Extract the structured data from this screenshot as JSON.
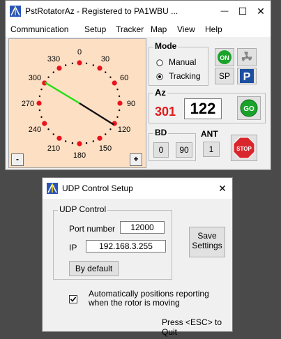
{
  "rotator": {
    "title": "PstRotatorAz - Registered to PA1WBU  ...",
    "caption": {
      "minimize": "—",
      "maximize": "☐",
      "close": "✕"
    },
    "menu": [
      "Communication",
      "Setup",
      "Tracker",
      "Map",
      "View",
      "Help"
    ],
    "dial": {
      "labels": [
        "0",
        "30",
        "60",
        "90",
        "120",
        "150",
        "180",
        "210",
        "240",
        "270",
        "300",
        "330"
      ],
      "green_bearing": 301,
      "black_bearing": 122,
      "minus": "-",
      "plus": "+"
    },
    "mode": {
      "title": "Mode",
      "manual": "Manual",
      "tracking": "Tracking",
      "selected": "tracking",
      "on_label": "ON",
      "sp_label": "SP",
      "p_label": "P"
    },
    "az": {
      "title": "Az",
      "target": "301",
      "current": "122",
      "go_label": "GO"
    },
    "bd": {
      "title": "BD",
      "btn0": "0",
      "btn90": "90"
    },
    "ant": {
      "title": "ANT",
      "btn1": "1"
    },
    "stop_label": "STOP"
  },
  "udp": {
    "title": "UDP Control Setup",
    "close": "✕",
    "group_title": "UDP Control",
    "port_label": "Port number",
    "port_value": "12000",
    "ip_label": "IP",
    "ip_value": "192.168.3.255",
    "default_btn": "By default",
    "save_btn_line1": "Save",
    "save_btn_line2": "Settings",
    "checkbox_checked": true,
    "checkbox_label_line1": "Automatically positions reporting",
    "checkbox_label_line2": "when the rotor is moving",
    "footer": "Press <ESC> to Quit"
  },
  "colors": {
    "dial_bg": "#fddfc3",
    "dot": "#e8141c",
    "green_needle": "#22e011",
    "black_needle": "#111111",
    "target_red": "#e01b1b",
    "go_green": "#1aa32a",
    "stop_red": "#d9262c"
  }
}
